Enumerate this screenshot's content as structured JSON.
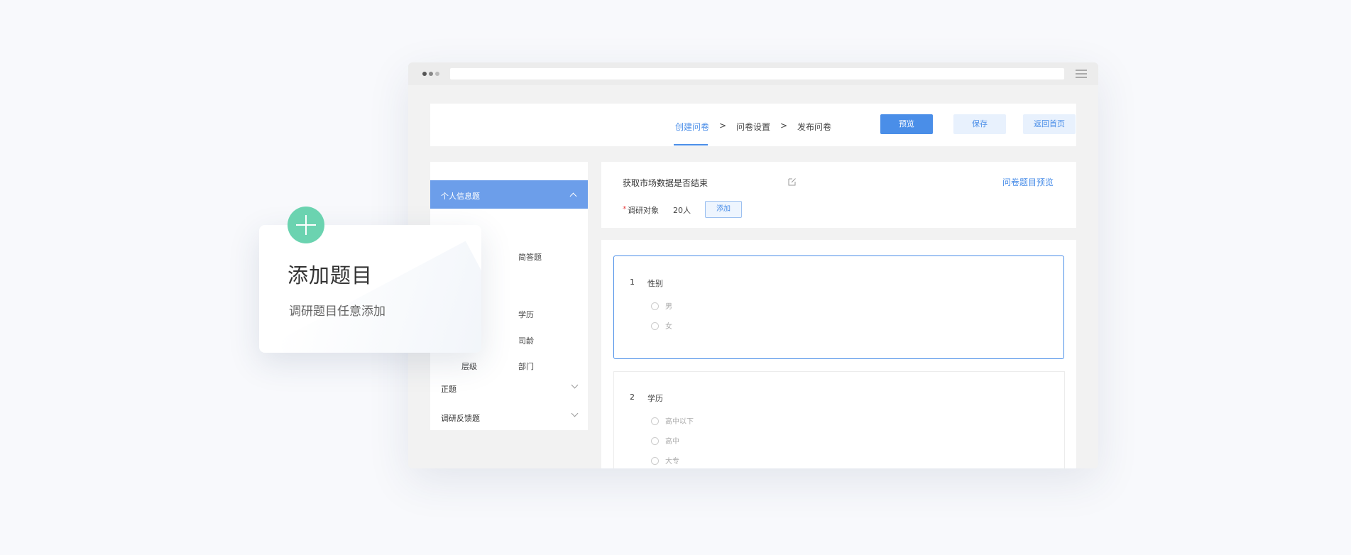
{
  "steps": [
    {
      "label": "创建问卷",
      "active": true
    },
    {
      "label": "问卷设置",
      "active": false
    },
    {
      "label": "发布问卷",
      "active": false
    }
  ],
  "step_separator": ">",
  "buttons": {
    "preview": "预览",
    "save": "保存",
    "home": "返回首页"
  },
  "sidebar": {
    "header": "个人信息题",
    "items": [
      "简答题",
      "学历",
      "司龄",
      "层级",
      "部门"
    ],
    "partial_items": [
      "",
      ""
    ],
    "groups": [
      "正题",
      "调研反馈题"
    ]
  },
  "survey": {
    "title": "获取市场数据是否结束",
    "preview_link": "问卷题目预览",
    "required_mark": "*",
    "target_label": "调研对象",
    "target_count": "20人",
    "add_button": "添加"
  },
  "questions": [
    {
      "number": "1",
      "title": "性别",
      "options": [
        "男",
        "女"
      ]
    },
    {
      "number": "2",
      "title": "学历",
      "options": [
        "高中以下",
        "高中",
        "大专"
      ]
    }
  ],
  "feature_card": {
    "title": "添加题目",
    "subtitle": "调研题目任意添加"
  },
  "colors": {
    "accent": "#4a8ee8",
    "sidebar_header": "#6c9eea",
    "plus_circle": "#6bd3b0"
  }
}
